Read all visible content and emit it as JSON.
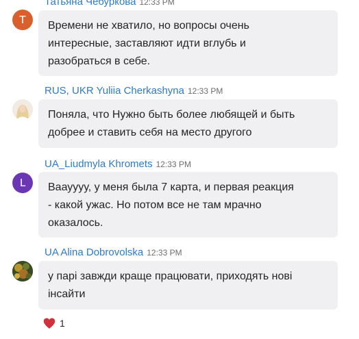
{
  "messages": [
    {
      "sender": "Татьяна Чебуркова",
      "time": "12:33 PM",
      "avatar_letter": "T",
      "avatar_color": "#d8602d",
      "lines": [
        "Времени не хватило, но вопросы очень",
        "интересные, заставляют идти вглубь и",
        "разобраться в себе."
      ]
    },
    {
      "sender": "RUS, UKR Yuliia Cherkashyna",
      "time": "12:33 PM",
      "avatar_type": "photo",
      "lines": [
        "Поняла, что Нужно быть более любящей и быть",
        "добрее и ставить себя на место другого"
      ]
    },
    {
      "sender": "UA_Liudmyla Khromets",
      "time": "12:33 PM",
      "avatar_letter": "L",
      "avatar_color": "#6b36b4",
      "lines": [
        "Ваауууу, у меня была 7 карта, и первая реакция",
        "- какой ужас. Но потом все не там мрачно",
        "оказалось."
      ]
    },
    {
      "sender": "UA Alina Dobrovolska",
      "time": "12:33 PM",
      "avatar_type": "photo",
      "lines": [
        "у парі завжди краще працювати, приходять нові",
        "інсайти"
      ]
    }
  ],
  "reaction": {
    "icon": "heart-icon",
    "color": "#d1313d",
    "count": "1"
  }
}
